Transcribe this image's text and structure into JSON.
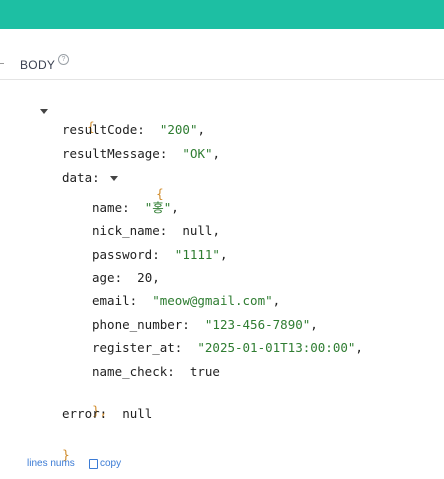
{
  "section": {
    "title": "BODY",
    "help_icon": "?"
  },
  "json": {
    "open_brace": "{",
    "close_brace": "}",
    "resultCode": {
      "key": "resultCode:",
      "value": "\"200\""
    },
    "resultMessage": {
      "key": "resultMessage:",
      "value": "\"OK\""
    },
    "data": {
      "key": "data:",
      "open_brace": "{",
      "close_brace": "},",
      "name": {
        "key": "name:",
        "value": "\"홍\""
      },
      "nick_name": {
        "key": "nick_name:",
        "value": "null"
      },
      "password": {
        "key": "password:",
        "value": "\"1111\""
      },
      "age": {
        "key": "age:",
        "value": "20"
      },
      "email": {
        "key": "email:",
        "value": "\"meow@gmail.com\""
      },
      "phone_number": {
        "key": "phone_number:",
        "value": "\"123-456-7890\""
      },
      "register_at": {
        "key": "register_at:",
        "value": "\"2025-01-01T13:00:00\""
      },
      "name_check": {
        "key": "name_check:",
        "value": "true"
      }
    },
    "error": {
      "key": "error:",
      "value": "null"
    }
  },
  "footer": {
    "lines_nums_label": "lines nums",
    "copy_label": "copy"
  }
}
